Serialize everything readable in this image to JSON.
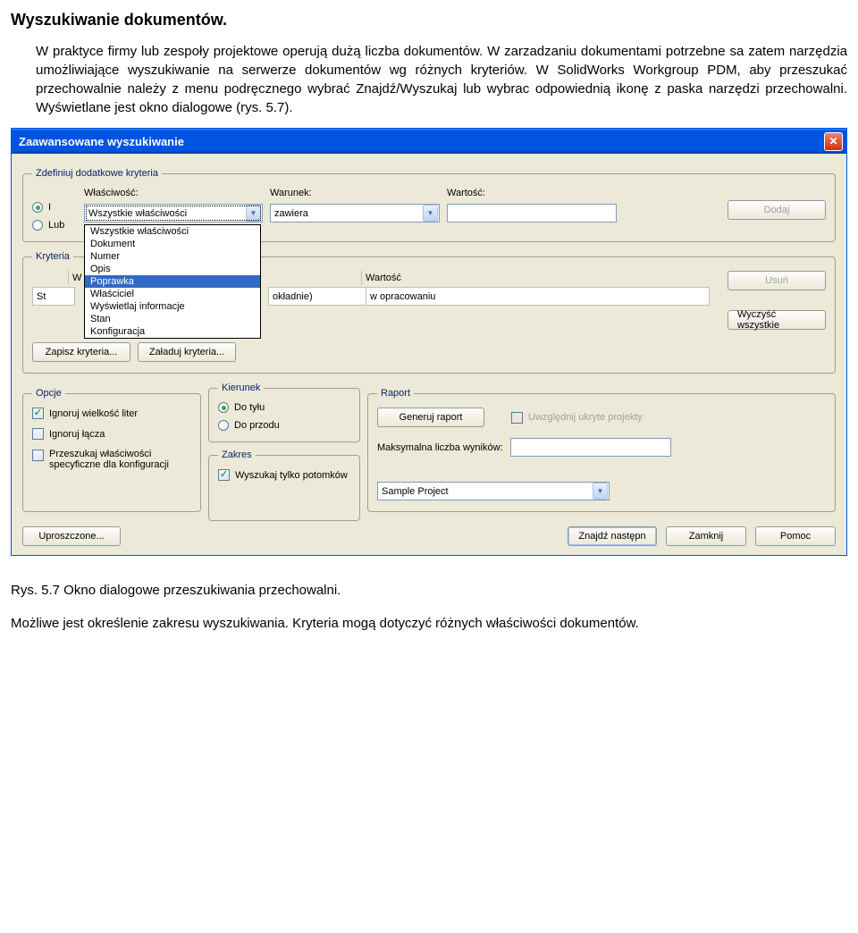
{
  "doc": {
    "title": "Wyszukiwanie dokumentów.",
    "para": "W praktyce firmy lub zespoły projektowe operują dużą liczba dokumentów. W zarzadzaniu dokumentami potrzebne sa zatem narzędzia umożliwiające wyszukiwanie na serwerze dokumentów wg różnych kryteriów. W SolidWorks Workgroup PDM, aby przeszukać przechowalnie należy z menu podręcznego wybrać Znajdź/Wyszukaj lub wybrac odpowiednią ikonę z paska narzędzi przechowalni. Wyświetlane jest okno dialogowe (rys. 5.7).",
    "caption": "Rys. 5.7 Okno dialogowe przeszukiwania przechowalni.",
    "footer": "Możliwe jest określenie zakresu wyszukiwania. Kryteria mogą dotyczyć różnych właściwości dokumentów."
  },
  "dialog": {
    "title": "Zaawansowane wyszukiwanie",
    "groups": {
      "define": {
        "legend": "Zdefiniuj dodatkowe kryteria",
        "radio_i": "I",
        "radio_lub": "Lub",
        "col_wlasnosc": "Właściwość:",
        "col_warunek": "Warunek:",
        "col_wartosc": "Wartość:",
        "combo_wlasnosc": "Wszystkie właściwości",
        "combo_warunek": "zawiera",
        "btn_dodaj": "Dodaj",
        "dropdown_items": [
          "Wszystkie właściwości",
          "Dokument",
          "Numer",
          "Opis",
          "Poprawka",
          "Właściciel",
          "Wyświetlaj informacje",
          "Stan",
          "Konfiguracja"
        ],
        "dropdown_selected": 4
      },
      "criteria": {
        "legend": "Kryteria",
        "col_w": "W",
        "col_wartosc": "Wartość",
        "row_st": "St",
        "row_cond": "okładnie)",
        "row_value": "w opracowaniu",
        "btn_usun": "Usuń",
        "btn_wyczysc": "Wyczyść wszystkie",
        "btn_zapisz": "Zapisz kryteria...",
        "btn_zaladuj": "Załaduj kryteria..."
      },
      "opcje": {
        "legend": "Opcje",
        "chk_ignoruj_liter": "Ignoruj wielkość liter",
        "chk_ignoruj_lacza": "Ignoruj łącza",
        "chk_przeszukaj": "Przeszukaj właściwości specyficzne dla konfiguracji"
      },
      "kierunek": {
        "legend": "Kierunek",
        "radio_dotylu": "Do tyłu",
        "radio_doprzodu": "Do przodu"
      },
      "raport": {
        "legend": "Raport",
        "btn_generuj": "Generuj raport",
        "chk_uwzglednij": "Uwzględnij ukryte projekty",
        "lbl_maks": "Maksymalna liczba wyników:"
      },
      "zakres": {
        "legend": "Zakres",
        "chk_wyszukaj": "Wyszukaj tylko potomków",
        "combo_project": "Sample Project"
      }
    },
    "buttons": {
      "uproszczone": "Uproszczone...",
      "znajdz": "Znajdź następn",
      "zamknij": "Zamknij",
      "pomoc": "Pomoc"
    }
  }
}
